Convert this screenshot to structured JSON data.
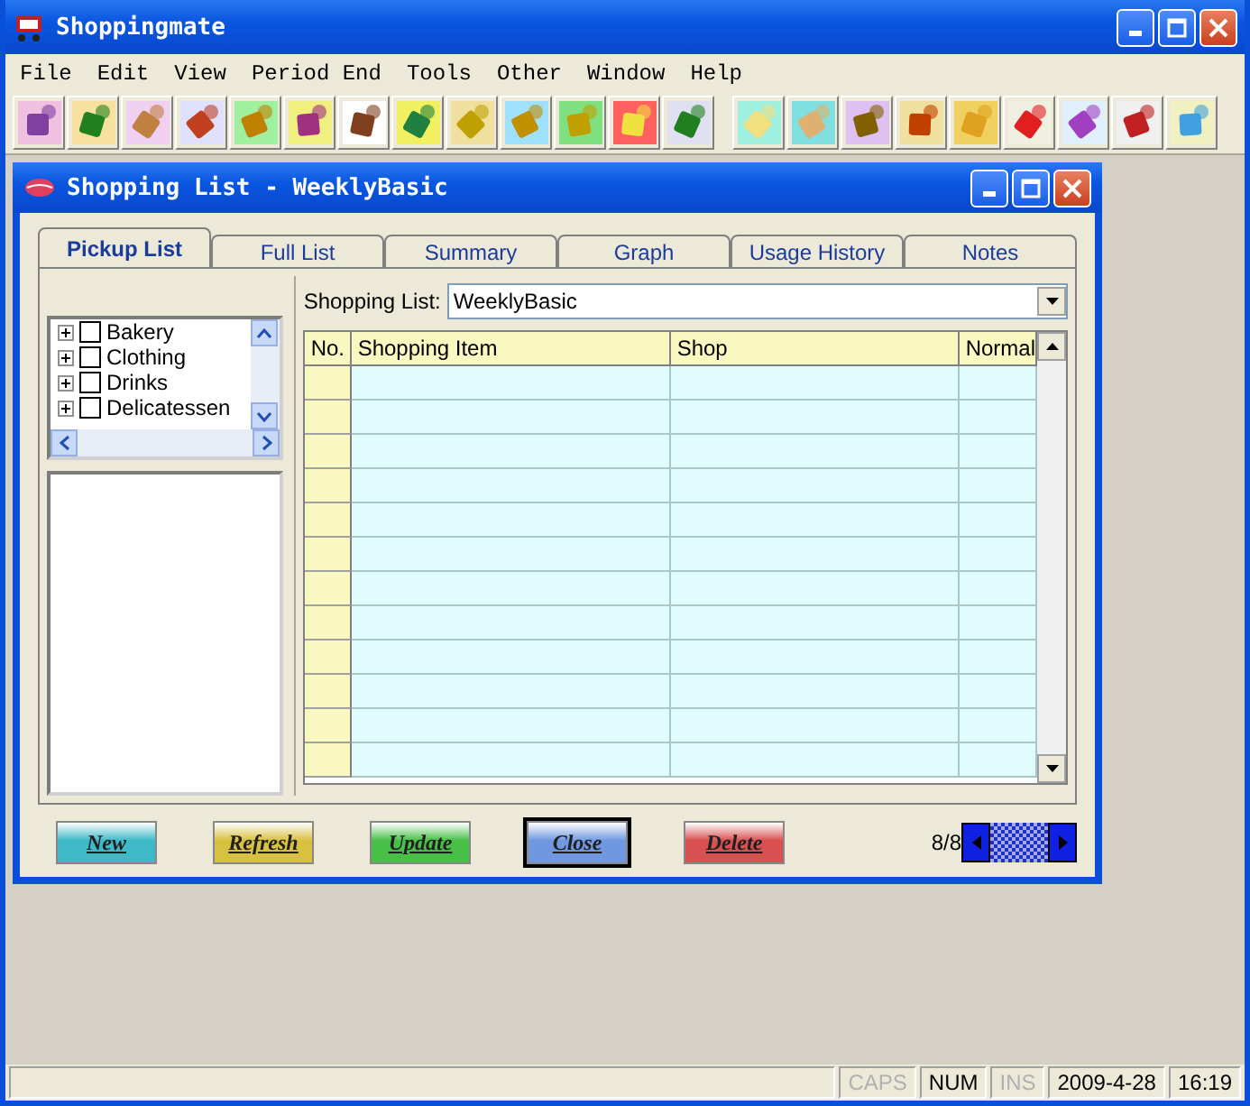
{
  "window": {
    "title": "Shoppingmate"
  },
  "menu": [
    "File",
    "Edit",
    "View",
    "Period End",
    "Tools",
    "Other",
    "Window",
    "Help"
  ],
  "child_window": {
    "title": "Shopping List - WeeklyBasic",
    "tabs": [
      {
        "label": "Pickup List",
        "selected": true
      },
      {
        "label": "Full List",
        "selected": false
      },
      {
        "label": "Summary",
        "selected": false
      },
      {
        "label": "Graph",
        "selected": false
      },
      {
        "label": "Usage History",
        "selected": false
      },
      {
        "label": "Notes",
        "selected": false
      }
    ],
    "categories": [
      {
        "label": "Bakery",
        "checked": false,
        "expanded": false
      },
      {
        "label": "Clothing",
        "checked": false,
        "expanded": false
      },
      {
        "label": "Drinks",
        "checked": false,
        "expanded": false
      },
      {
        "label": "Delicatessen",
        "checked": false,
        "expanded": false
      }
    ],
    "shopping_list": {
      "label": "Shopping List:",
      "value": "WeeklyBasic"
    },
    "table": {
      "columns": [
        "No.",
        "Shopping Item",
        "Shop",
        "Normal"
      ]
    },
    "buttons": [
      {
        "label": "New",
        "color": "#3fb8c8"
      },
      {
        "label": "Refresh",
        "color": "#d8c040"
      },
      {
        "label": "Update",
        "color": "#48c048"
      },
      {
        "label": "Close",
        "color": "#7098e0"
      },
      {
        "label": "Delete",
        "color": "#d85050"
      }
    ],
    "record_position": "8/8"
  },
  "status_bar": [
    {
      "label": "CAPS",
      "enabled": false
    },
    {
      "label": "NUM",
      "enabled": true
    },
    {
      "label": "INS",
      "enabled": false
    },
    {
      "label": "2009-4-28",
      "enabled": true
    },
    {
      "label": "16:19",
      "enabled": true
    }
  ]
}
